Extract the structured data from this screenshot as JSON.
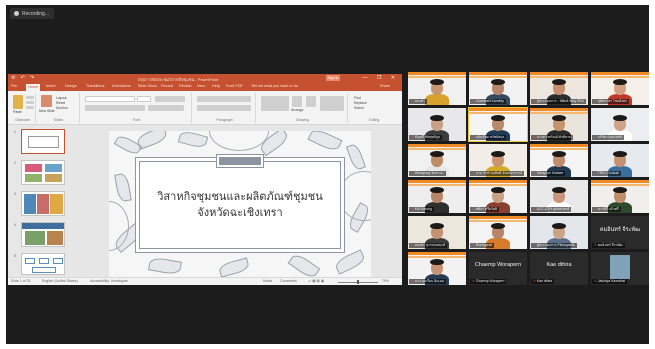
{
  "recording": {
    "label": "Recording..."
  },
  "ppt": {
    "quick_access": "⟲ ↶ ↷",
    "doc_title": "สรุปการจัดประชุมวิสาหกิจชุมชน - PowerPoint",
    "sign_in": "Sign in",
    "window_controls": "— ❐ ✕",
    "tabs": [
      "File",
      "Home",
      "Insert",
      "Design",
      "Transitions",
      "Animations",
      "Slide Show",
      "Record",
      "Review",
      "View",
      "Help",
      "Foxit PDF",
      "Tell me what you want to do"
    ],
    "share": "Share",
    "ribbon_groups": [
      "Clipboard",
      "Slides",
      "Font",
      "Paragraph",
      "Drawing",
      "Editing"
    ],
    "ribbon_labels": {
      "paste": "Paste",
      "new_slide": "New Slide",
      "layout": "Layout",
      "reset": "Reset",
      "section": "Section",
      "arrange": "Arrange",
      "find": "Find",
      "replace": "Replace",
      "select": "Select"
    },
    "thumb_numbers": [
      "1",
      "2",
      "3",
      "4",
      "5"
    ],
    "slide_line1": "วิสาหกิจชุมชนและผลิตภัณฑ์ชุมชน",
    "slide_line2": "จังหวัดฉะเชิงเทรา",
    "status": {
      "slide": "Slide 1 of 33",
      "lang": "English (United States)",
      "access": "Accessibility: Investigate",
      "notes": "Notes",
      "comments": "Comments",
      "zoom": "79%"
    }
  },
  "gallery": [
    {
      "name": "ทองคำ"
    },
    {
      "name": "Chaowalit Kamthip"
    },
    {
      "name": "ผู้ประกอบการ - นิพิทธ์ พิศดู RBU"
    },
    {
      "name": "สุพัตราพร ไชยตั้งพร"
    },
    {
      "name": "อัญชลี ทัพสุทธิกูล"
    },
    {
      "name": "ธนินธ์พล ทรัพย์สกุล"
    },
    {
      "name": "นางสาวศรัณย์ ศักดิ์ทาน"
    },
    {
      "name": "อภิชัย แพนเชสท์"
    },
    {
      "name": "Warapong จิตชวนะ"
    },
    {
      "name": "นาย ชาติ ชมทิพย์ จันทรอาจารย์"
    },
    {
      "name": "Tanaporn Kraisee"
    },
    {
      "name": "TRIN Chulsak"
    },
    {
      "name": "Krit Narong"
    },
    {
      "name": "ศศิธร ศรีสวัสดิ์"
    },
    {
      "name": "ACC-UTH ยุทธศาสตร์"
    },
    {
      "name": "ดาวสิรี แก้วศรี"
    },
    {
      "name": "ทองพร สุวรรณพฤกษ์"
    },
    {
      "name": "Ruengchai"
    },
    {
      "name": "ผู้ประกอบการ Pitchayarat"
    },
    {
      "name": "คมอินทร์ จีระพัฒ"
    },
    {
      "name": "นาง อุ่นเรือน อิ่มเอม"
    },
    {
      "name": "Chaemp Worapern",
      "label": "Chaemp Worapern"
    },
    {
      "name": "Kae dthira",
      "label": "Kae dthira"
    },
    {
      "name": "Jakkriya Kaewthai"
    }
  ],
  "big_label_19": "คมอินทร์ จีระพัฒ"
}
